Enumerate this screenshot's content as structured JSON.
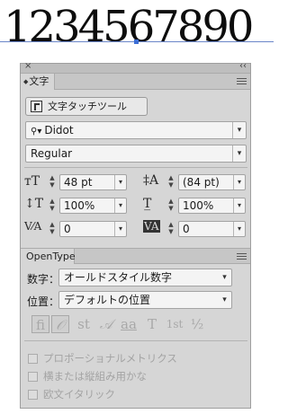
{
  "sample_text": "1234567890",
  "panel": {
    "close_glyph": "×",
    "collapse_glyph": "‹‹",
    "tab_label": "文字",
    "tab_collapse_glyph": "◆"
  },
  "tool_button_label": "文字タッチツール",
  "font_family": "Didot",
  "font_style": "Regular",
  "metrics": {
    "size": "48 pt",
    "leading": "(84 pt)",
    "vscale": "100%",
    "hscale": "100%",
    "kerning": "0",
    "tracking": "0"
  },
  "opentype": {
    "tab_label": "OpenType",
    "figure_label": "数字：",
    "figure_value": "オールドスタイル数字",
    "position_label": "位置：",
    "position_value": "デフォルトの位置",
    "glyph_buttons": [
      "fi",
      "𝒪",
      "st",
      "𝒜",
      "aa",
      "T",
      "1st",
      "½"
    ],
    "checkboxes": [
      "プロポーショナルメトリクス",
      "横または縦組み用かな",
      "欧文イタリック"
    ]
  },
  "colors": {
    "panel_bg": "#d6d6d6",
    "baseline": "#6b86c9"
  }
}
